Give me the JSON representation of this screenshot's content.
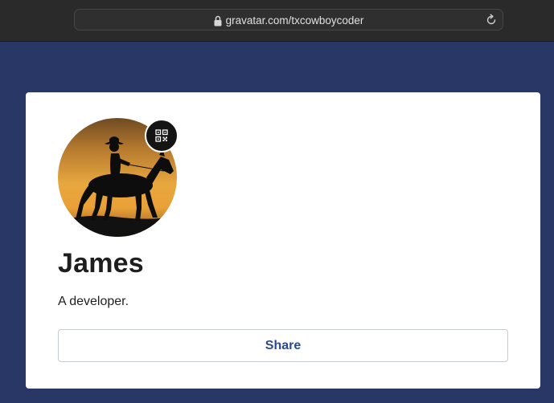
{
  "browser": {
    "url": "gravatar.com/txcowboycoder",
    "lock_icon": "lock-icon",
    "reload_icon": "reload-icon"
  },
  "profile": {
    "name": "James",
    "bio": "A developer.",
    "share_label": "Share",
    "qr_icon": "qr-code-icon",
    "avatar": "silhouette of cowboy on horse at sunset"
  },
  "colors": {
    "page_background": "#283766",
    "card_background": "#ffffff",
    "share_text": "#2c4a94",
    "titlebar": "#2a2a2a"
  }
}
